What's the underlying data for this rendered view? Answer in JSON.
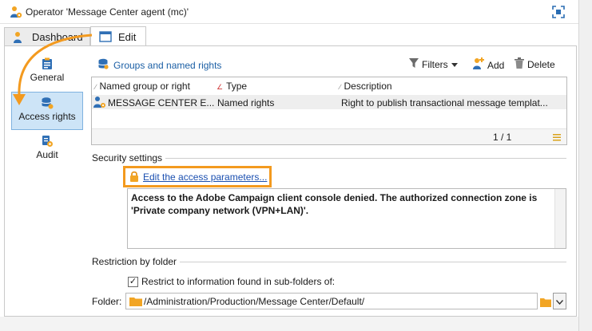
{
  "window": {
    "title": "Operator 'Message Center agent (mc)'"
  },
  "tabs": [
    {
      "label": "Dashboard"
    },
    {
      "label": "Edit"
    }
  ],
  "nav": {
    "items": [
      {
        "label": "General"
      },
      {
        "label": "Access rights"
      },
      {
        "label": "Audit"
      }
    ]
  },
  "grid": {
    "title": "Groups and named rights",
    "toolbar": {
      "filters": "Filters",
      "add": "Add",
      "delete": "Delete"
    },
    "columns": [
      "Named group or right",
      "Type",
      "Description"
    ],
    "rows": [
      {
        "name": "MESSAGE CENTER E...",
        "type": "Named rights",
        "description": "Right to publish transactional message templat..."
      }
    ],
    "pager": "1 / 1"
  },
  "security": {
    "label": "Security settings",
    "link": "Edit the access parameters...",
    "message": "Access to the Adobe Campaign client console denied. The authorized connection zone is 'Private company network (VPN+LAN)'."
  },
  "restriction": {
    "label": "Restriction by folder",
    "checkbox_label": "Restrict to information found in sub-folders of:",
    "checked": true,
    "folder_label": "Folder:",
    "folder_value": "/Administration/Production/Message Center/Default/"
  },
  "colors": {
    "accent_orange": "#f39a1f",
    "link_blue": "#1a4fb0",
    "selection_blue": "#cde4f7"
  }
}
